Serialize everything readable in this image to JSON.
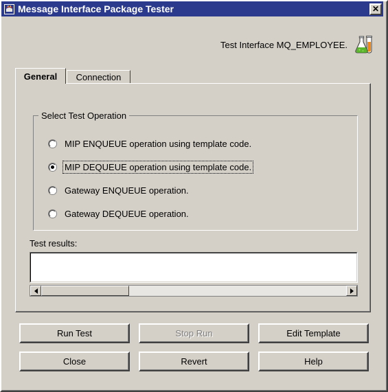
{
  "window": {
    "title": "Message Interface Package Tester",
    "icon": "app-emblem-icon",
    "close_label": "✕"
  },
  "header": {
    "text": "Test Interface MQ_EMPLOYEE.",
    "icon": "flask-icon"
  },
  "tabs": [
    {
      "label": "General",
      "active": true
    },
    {
      "label": "Connection",
      "active": false
    }
  ],
  "group": {
    "title": "Select Test Operation",
    "options": [
      {
        "label": "MIP ENQUEUE operation using template code.",
        "selected": false,
        "focused": false
      },
      {
        "label": "MIP DEQUEUE operation using template code.",
        "selected": true,
        "focused": true
      },
      {
        "label": "Gateway ENQUEUE operation.",
        "selected": false,
        "focused": false
      },
      {
        "label": "Gateway DEQUEUE operation.",
        "selected": false,
        "focused": false
      }
    ]
  },
  "results": {
    "label": "Test results:",
    "value": "",
    "scrollbar": {
      "left_arrow": "◄",
      "right_arrow": "►"
    }
  },
  "buttons": {
    "run_test": "Run Test",
    "stop_run": "Stop Run",
    "edit_template": "Edit Template",
    "close": "Close",
    "revert": "Revert",
    "help": "Help"
  },
  "colors": {
    "titlebar": "#2b3a8c",
    "face": "#d4d0c8",
    "shadow": "#808080",
    "dark": "#404040",
    "light": "#ffffff",
    "field": "#ffffff",
    "disabled_text": "#808080"
  }
}
